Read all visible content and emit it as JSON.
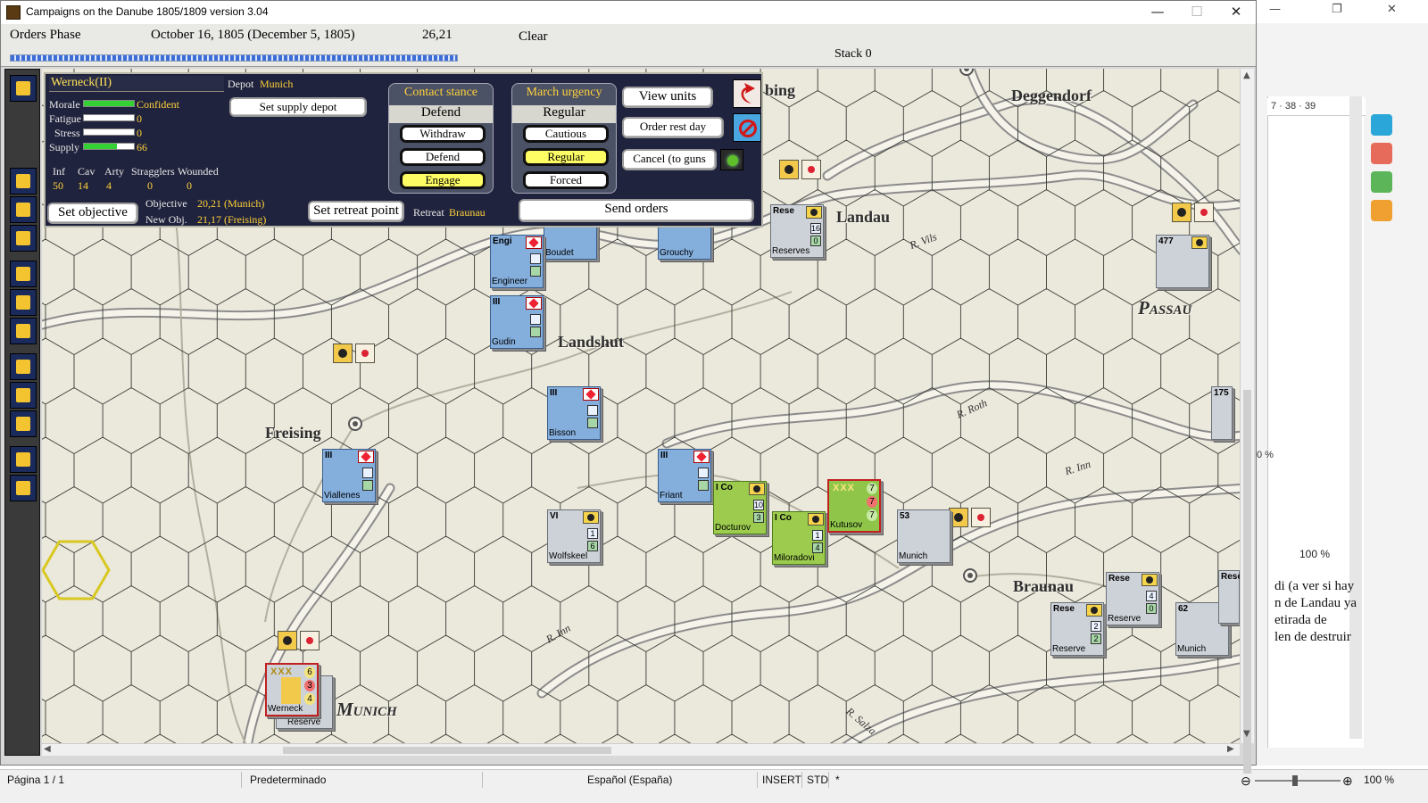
{
  "window": {
    "title": "Campaigns on the Danube 1805/1809  version 3.04"
  },
  "infobar": {
    "phase": "Orders Phase",
    "date": "October 16, 1805 (December 5, 1805)",
    "hex": "26,21",
    "weather": "Clear",
    "stack": "Stack 0",
    "progress": 1.0
  },
  "panel": {
    "leader": "Werneck(II)",
    "depot_label": "Depot",
    "depot": "Munich",
    "set_supply_depot": "Set supply depot",
    "stats": [
      {
        "label": "Morale",
        "value": "Confident",
        "fill": 1.0
      },
      {
        "label": "Fatigue",
        "value": "0",
        "fill": 0.0
      },
      {
        "label": "Stress",
        "value": "0",
        "fill": 0.0
      },
      {
        "label": "Supply",
        "value": "66",
        "fill": 0.66
      }
    ],
    "strength_headers": [
      "Inf",
      "Cav",
      "Arty",
      "Stragglers",
      "Wounded"
    ],
    "strength_values": [
      "50",
      "14",
      "4",
      "0",
      "0"
    ],
    "objective_label": "Objective",
    "objective": "20,21 (Munich)",
    "new_obj_label": "New Obj.",
    "new_obj": "21,17 (Freising)",
    "set_objective": "Set objective",
    "set_retreat_point": "Set retreat point",
    "retreat_label": "Retreat",
    "retreat": "Braunau",
    "contact_stance": {
      "title": "Contact stance",
      "current": "Defend",
      "options": [
        "Withdraw",
        "Defend",
        "Engage"
      ],
      "active": "Engage"
    },
    "march_urgency": {
      "title": "March urgency",
      "current": "Regular",
      "options": [
        "Cautious",
        "Regular",
        "Forced"
      ],
      "active": "Regular"
    },
    "view_units": "View units",
    "order_rest_day": "Order rest day",
    "cancel_to_guns": "Cancel (to guns",
    "send_orders": "Send orders"
  },
  "map": {
    "towns": [
      "Deggendorf",
      "Landau",
      "Passau",
      "Landshut",
      "Freising",
      "Braunau",
      "Munich",
      "bing"
    ],
    "rivers": [
      "R. Vils",
      "R. Roth",
      "R. Inn",
      "R. Inn",
      "R. Salza"
    ],
    "units": [
      {
        "side": "fr",
        "size": "",
        "name": "Boudet",
        "boxes": [
          "",
          ""
        ]
      },
      {
        "side": "fr",
        "size": "",
        "name": "Grouchy",
        "boxes": [
          "",
          ""
        ]
      },
      {
        "side": "fr",
        "size": "Engi",
        "name": "Engineer",
        "boxes": [
          "",
          ""
        ]
      },
      {
        "side": "fr",
        "size": "III",
        "name": "Gudin",
        "boxes": [
          "",
          ""
        ]
      },
      {
        "side": "fr",
        "size": "III",
        "name": "Bisson",
        "boxes": [
          "",
          ""
        ]
      },
      {
        "side": "fr",
        "size": "III",
        "name": "Viallenes",
        "boxes": [
          "",
          ""
        ]
      },
      {
        "side": "fr",
        "size": "III",
        "name": "Friant",
        "boxes": [
          "",
          ""
        ]
      },
      {
        "side": "aus",
        "size": "VI",
        "name": "Wolfskeel",
        "boxes": [
          "1",
          "6"
        ]
      },
      {
        "side": "rus",
        "size": "I Co",
        "name": "Docturov",
        "boxes": [
          "10",
          "3"
        ]
      },
      {
        "side": "rus",
        "size": "I Co",
        "name": "Miloradovi",
        "boxes": [
          "1",
          "4"
        ]
      },
      {
        "side": "aus",
        "size": "Rese",
        "name": "Reserves",
        "boxes": [
          "16",
          "0"
        ]
      },
      {
        "side": "aus",
        "size": "53",
        "name": "Munich",
        "boxes": [
          "",
          ""
        ]
      },
      {
        "side": "aus",
        "size": "Rese",
        "name": "Reserve",
        "boxes": [
          "2",
          "2"
        ]
      },
      {
        "side": "aus",
        "size": "Rese",
        "name": "Reserve",
        "boxes": [
          "4",
          "0"
        ]
      },
      {
        "side": "aus",
        "size": "62",
        "name": "Munich",
        "boxes": [
          "",
          ""
        ]
      },
      {
        "side": "aus",
        "size": "477",
        "name": "",
        "boxes": [
          "",
          ""
        ]
      },
      {
        "side": "aus",
        "size": "175",
        "name": "",
        "boxes": [
          "",
          ""
        ]
      },
      {
        "side": "aus",
        "size": "Rese",
        "name": "Rese",
        "boxes": [
          "",
          ""
        ]
      }
    ],
    "leaders": [
      {
        "name": "Kutusov",
        "rank": "XXX",
        "values": [
          "7",
          "7",
          "7"
        ],
        "color": "rus"
      },
      {
        "name": "Werneck",
        "rank": "XXX",
        "values": [
          "6",
          "3",
          "4"
        ],
        "color": "aus",
        "under": "Reserve"
      }
    ]
  },
  "background_app": {
    "ruler": "7 · 38 · 39",
    "text_lines": [
      "di (a ver si hay",
      "n de Landau ya",
      "etirada de",
      "len de destruir"
    ],
    "zoom_small": "0 %",
    "zoom_panel": "100 %",
    "status": {
      "page": "Página  1 / 1",
      "style": "Predeterminado",
      "language": "Español (España)",
      "insert": "INSERT",
      "std": "STD",
      "mark": "*",
      "zoom": "100 %"
    }
  },
  "colors": {
    "panel_bg": "#20233d",
    "french": "#84aedc",
    "russian": "#9ccb4e",
    "austrian": "#cdd2d8",
    "accent_yellow": "#ffd23a",
    "active_button": "#fffd64",
    "supply_bar": "#33d133"
  }
}
